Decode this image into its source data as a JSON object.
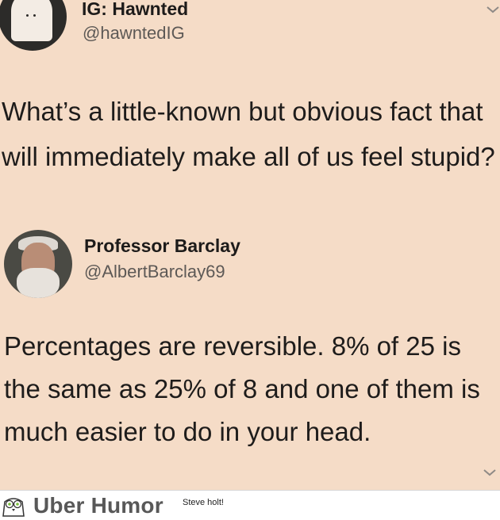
{
  "tweet1": {
    "name": "IG: Hawnted",
    "handle": "@hawntedIG",
    "text": "What’s a little-known but obvious fact that will immediately make all of us feel stupid?",
    "avatar_icon": "ghost-avatar"
  },
  "tweet2": {
    "name": "Professor Barclay",
    "handle": "@AlbertBarclay69",
    "text": "Percentages are reversible.  8% of 25 is the same as 25% of 8 and one of them is much easier to do in your head.",
    "avatar_icon": "bearded-man-avatar"
  },
  "footer": {
    "brand": "Uber Humor",
    "caption": "Steve holt!",
    "logo_icon": "owl-icon"
  },
  "colors": {
    "background": "#f5dcc7",
    "text": "#1e1c1b",
    "handle": "#5d5956",
    "footer_bg": "#ffffff",
    "brand": "#585858"
  }
}
